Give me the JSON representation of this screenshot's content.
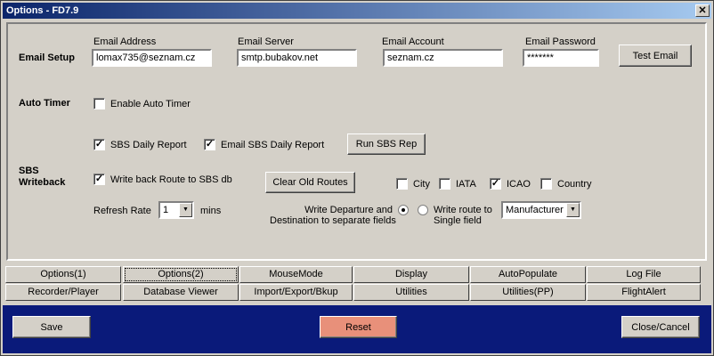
{
  "window": {
    "title": "Options - FD7.9",
    "close_glyph": "✕"
  },
  "email_setup": {
    "section_label": "Email Setup",
    "address_label": "Email Address",
    "address_value": "lomax735@seznam.cz",
    "server_label": "Email Server",
    "server_value": "smtp.bubakov.net",
    "account_label": "Email Account",
    "account_value": "seznam.cz",
    "password_label": "Email Password",
    "password_value": "*******",
    "test_button": "Test Email"
  },
  "auto_timer": {
    "section_label": "Auto Timer",
    "enable_label": "Enable Auto Timer",
    "enable_checked": false
  },
  "sbs": {
    "section_label_line1": "SBS",
    "section_label_line2": "Writeback",
    "daily_report_label": "SBS Daily Report",
    "daily_report_checked": true,
    "email_daily_report_label": "Email SBS Daily Report",
    "email_daily_report_checked": true,
    "run_report_button": "Run SBS Rep",
    "write_back_label": "Write back Route to SBS db",
    "write_back_checked": true,
    "clear_routes_button": "Clear Old Routes",
    "city_label": "City",
    "city_checked": false,
    "iata_label": "IATA",
    "iata_checked": false,
    "icao_label": "ICAO",
    "icao_checked": true,
    "country_label": "Country",
    "country_checked": false,
    "refresh_rate_label": "Refresh Rate",
    "refresh_rate_value": "1",
    "mins_label": "mins",
    "radio_separate_line1": "Write Departure and",
    "radio_separate_line2": "Destination to separate fields",
    "radio_separate_selected": true,
    "radio_single_line1": "Write route to",
    "radio_single_line2": "Single field",
    "radio_single_selected": false,
    "field_select_value": "Manufacturer"
  },
  "tabs": {
    "row1": [
      "Options(1)",
      "Options(2)",
      "MouseMode",
      "Display",
      "AutoPopulate",
      "Log File"
    ],
    "row2": [
      "Recorder/Player",
      "Database Viewer",
      "Import/Export/Bkup",
      "Utilities",
      "Utilities(PP)",
      "FlightAlert"
    ],
    "active": "Options(2)"
  },
  "footer": {
    "save_button": "Save",
    "reset_button": "Reset",
    "close_button": "Close/Cancel",
    "reset_color": "#e8907a",
    "bar_color": "#0a1a7a"
  },
  "icons": {
    "check": "✓",
    "dropdown": "▼"
  }
}
